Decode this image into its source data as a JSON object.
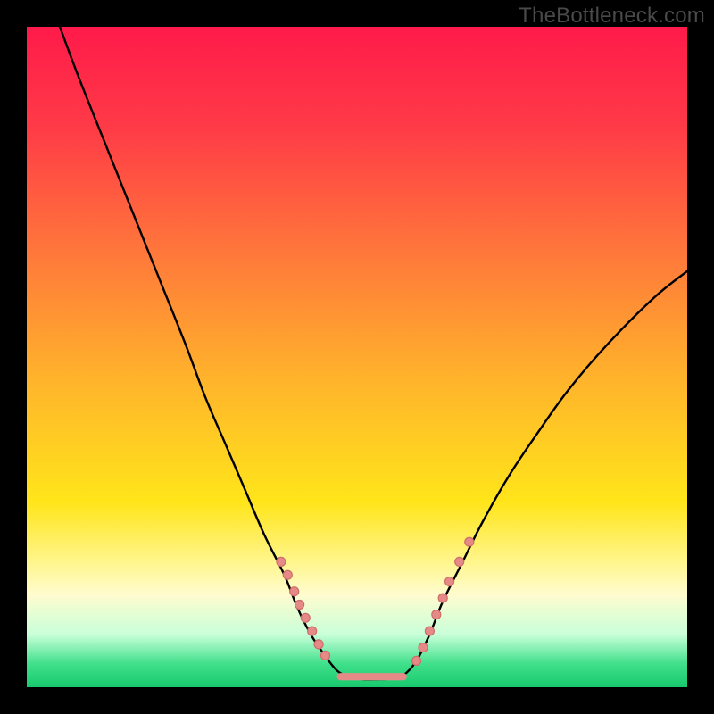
{
  "watermark": "TheBottleneck.com",
  "colors": {
    "frame": "#000000",
    "gradient_stops": [
      {
        "offset": 0.0,
        "color": "#ff1a4a"
      },
      {
        "offset": 0.15,
        "color": "#ff3a47"
      },
      {
        "offset": 0.35,
        "color": "#ff7a3a"
      },
      {
        "offset": 0.55,
        "color": "#ffb82a"
      },
      {
        "offset": 0.72,
        "color": "#ffe51a"
      },
      {
        "offset": 0.82,
        "color": "#fff799"
      },
      {
        "offset": 0.86,
        "color": "#fffccf"
      },
      {
        "offset": 0.92,
        "color": "#c9ffd9"
      },
      {
        "offset": 0.965,
        "color": "#3fe08a"
      },
      {
        "offset": 1.0,
        "color": "#18c96e"
      }
    ],
    "curve_stroke": "#000000",
    "dot_fill": "#e58a87",
    "dot_stroke": "#cf6d6a"
  },
  "chart_data": {
    "type": "line",
    "title": "",
    "xlabel": "",
    "ylabel": "",
    "xlim": [
      0,
      100
    ],
    "ylim": [
      0,
      100
    ],
    "series": [
      {
        "name": "left-curve",
        "x": [
          5,
          8,
          12,
          16,
          20,
          24,
          27,
          30,
          33,
          36,
          39,
          41,
          43,
          45,
          47,
          49
        ],
        "y": [
          100,
          92,
          82,
          72,
          62,
          52,
          44,
          37,
          30,
          23,
          17,
          12,
          8,
          5,
          2.5,
          1.5
        ]
      },
      {
        "name": "valley-floor",
        "x": [
          49,
          51,
          53,
          55,
          57
        ],
        "y": [
          1.5,
          1.2,
          1.2,
          1.3,
          1.8
        ]
      },
      {
        "name": "right-curve",
        "x": [
          57,
          59,
          61,
          63,
          66,
          69,
          73,
          77,
          82,
          88,
          95,
          100
        ],
        "y": [
          1.8,
          4,
          8,
          13,
          19,
          25,
          32,
          38,
          45,
          52,
          59,
          63
        ]
      }
    ],
    "dots_left_branch": [
      {
        "x": 38.5,
        "y": 19,
        "r": 1.0
      },
      {
        "x": 39.5,
        "y": 17,
        "r": 1.3
      },
      {
        "x": 40.5,
        "y": 14.5,
        "r": 1.0
      },
      {
        "x": 41.3,
        "y": 12.5,
        "r": 1.0
      },
      {
        "x": 42.2,
        "y": 10.5,
        "r": 1.3
      },
      {
        "x": 43.2,
        "y": 8.5,
        "r": 1.0
      },
      {
        "x": 44.2,
        "y": 6.5,
        "r": 1.0
      },
      {
        "x": 45.2,
        "y": 4.8,
        "r": 1.1
      }
    ],
    "dots_right_branch": [
      {
        "x": 59.0,
        "y": 4.0,
        "r": 1.0
      },
      {
        "x": 60.0,
        "y": 6.0,
        "r": 1.3
      },
      {
        "x": 61.0,
        "y": 8.5,
        "r": 1.1
      },
      {
        "x": 62.0,
        "y": 11.0,
        "r": 1.3
      },
      {
        "x": 63.0,
        "y": 13.5,
        "r": 1.3
      },
      {
        "x": 64.0,
        "y": 16.0,
        "r": 1.1
      },
      {
        "x": 65.5,
        "y": 19.0,
        "r": 1.0
      },
      {
        "x": 67.0,
        "y": 22.0,
        "r": 1.0
      }
    ],
    "floor_segment": {
      "x0": 47.5,
      "x1": 57.0,
      "y": 1.6,
      "thickness": 2.0
    }
  }
}
